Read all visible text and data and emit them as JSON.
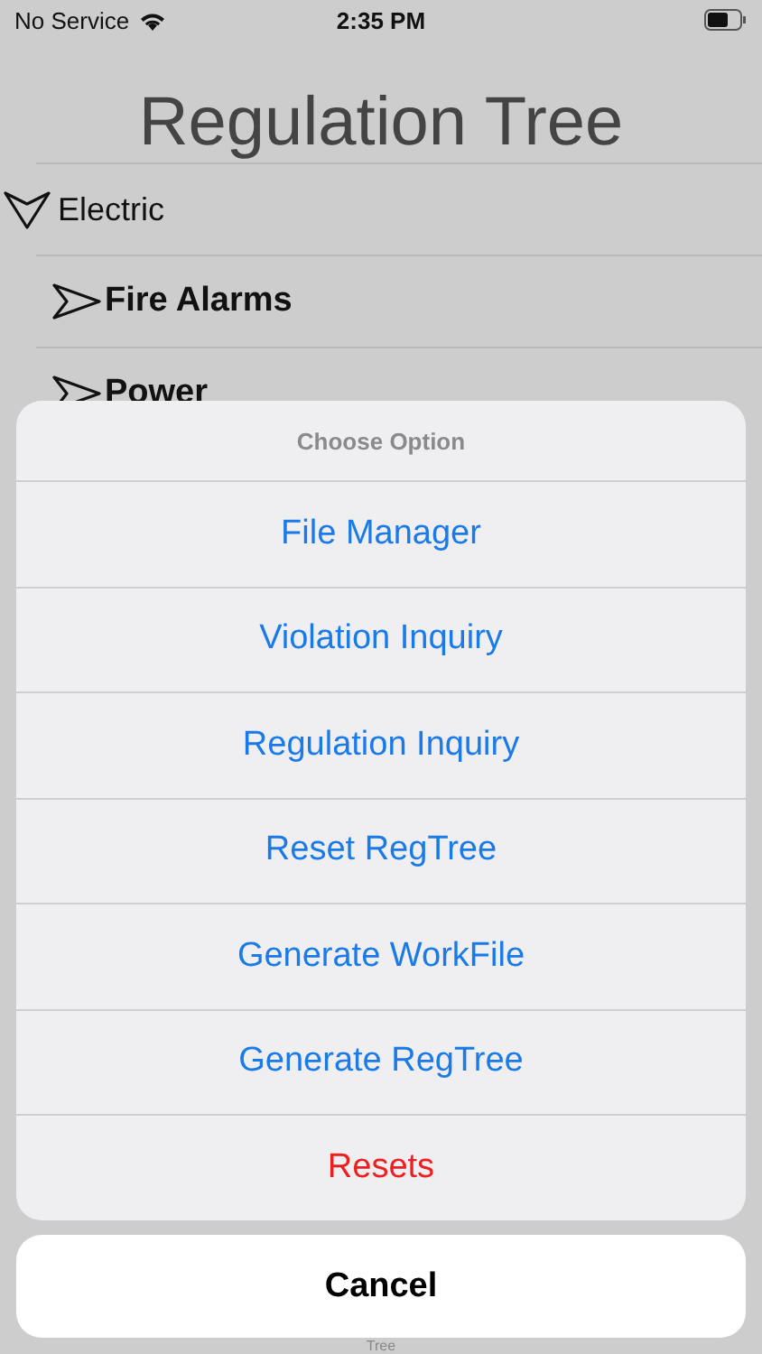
{
  "status_bar": {
    "carrier": "No Service",
    "time": "2:35 PM"
  },
  "title": "Regulation Tree",
  "tree": [
    {
      "label": "Electric",
      "expanded": true,
      "children": [
        {
          "label": "Fire Alarms",
          "expanded": false
        },
        {
          "label": "Power",
          "expanded": false
        }
      ]
    }
  ],
  "action_sheet": {
    "title": "Choose Option",
    "options": [
      {
        "label": "File Manager",
        "kind": "default"
      },
      {
        "label": "Violation Inquiry",
        "kind": "default"
      },
      {
        "label": "Regulation Inquiry",
        "kind": "default"
      },
      {
        "label": "Reset RegTree",
        "kind": "default"
      },
      {
        "label": "Generate WorkFile",
        "kind": "default"
      },
      {
        "label": "Generate RegTree",
        "kind": "default"
      },
      {
        "label": "Resets",
        "kind": "destructive"
      }
    ],
    "cancel": "Cancel"
  },
  "bottom_label": "Tree"
}
